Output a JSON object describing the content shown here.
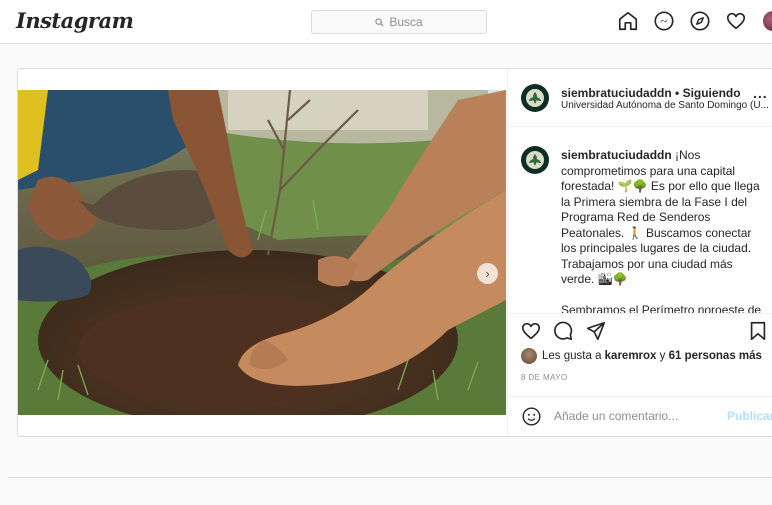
{
  "header": {
    "logo": "Instagram",
    "search_placeholder": "Busca",
    "icons": [
      "home-icon",
      "messenger-icon",
      "explore-icon",
      "heart-icon",
      "profile-avatar"
    ]
  },
  "post": {
    "username": "siembratuciudaddn",
    "separator": " • ",
    "following": "Siguiendo",
    "location": "Universidad Autónoma de Santo Domingo (U...",
    "more": "...",
    "caption_user": "siembratuciudaddn",
    "caption_text": " ¡Nos comprometimos para una capital forestada! 🌱🌳 Es por ello que llega la Primera siembra de la Fase I del Programa Red de Senderos Peatonales. 🚶 Buscamos conectar los principales lugares de la ciudad. Trabajamos por una ciudad más verde. 🏙🌳",
    "caption_more": "Sembramos el Perímetro noroeste de",
    "likes_prefix": "Les gusta a ",
    "likes_user": "karemrox",
    "likes_middle": " y ",
    "likes_count": "61 personas más",
    "date": "8 DE MAYO",
    "comment_placeholder": "Añade un comentario...",
    "publish": "Publicar",
    "next_arrow": "›",
    "colors": {
      "accent": "#0095f6",
      "publish_disabled": "#b2dffc",
      "border": "#dbdbdb"
    }
  }
}
